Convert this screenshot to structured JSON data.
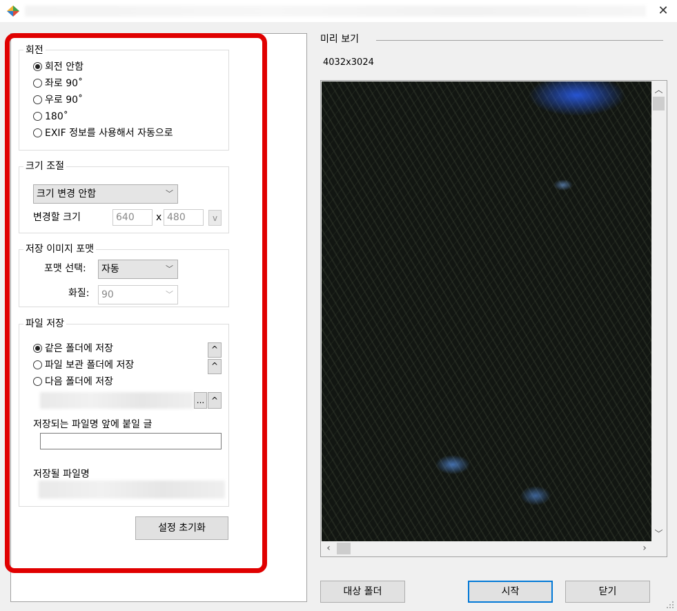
{
  "window": {
    "close_glyph": "✕"
  },
  "rotation": {
    "title": "회전",
    "options": [
      "회전 안함",
      "좌로 90˚",
      "우로 90˚",
      "180˚",
      "EXIF 정보를 사용해서 자동으로"
    ],
    "selected_index": 0
  },
  "resize": {
    "title": "크기 조절",
    "mode_value": "크기 변경 안함",
    "size_label": "변경할 크기",
    "width_value": "640",
    "x_label": "x",
    "height_value": "480",
    "preset_button": "v"
  },
  "format": {
    "title": "저장 이미지 포맷",
    "select_label": "포맷 선택:",
    "format_value": "자동",
    "quality_label": "화질:",
    "quality_value": "90"
  },
  "file_save": {
    "title": "파일 저장",
    "options": [
      "같은 폴더에 저장",
      "파일 보관 폴더에 저장",
      "다음 폴더에 저장"
    ],
    "selected_index": 0,
    "up_button": "^",
    "browse_button": "...",
    "prefix_label": "저장되는 파일명 앞에 붙일 글",
    "prefix_value": "",
    "filename_label": "저장될 파일명"
  },
  "reset_button": "설정 초기화",
  "preview": {
    "title": "미리 보기",
    "dimensions": "4032x3024"
  },
  "buttons": {
    "target_folder": "대상 폴더",
    "start": "시작",
    "close": "닫기"
  },
  "colors": {
    "highlight": "#e00000",
    "primary_border": "#0078d7"
  }
}
